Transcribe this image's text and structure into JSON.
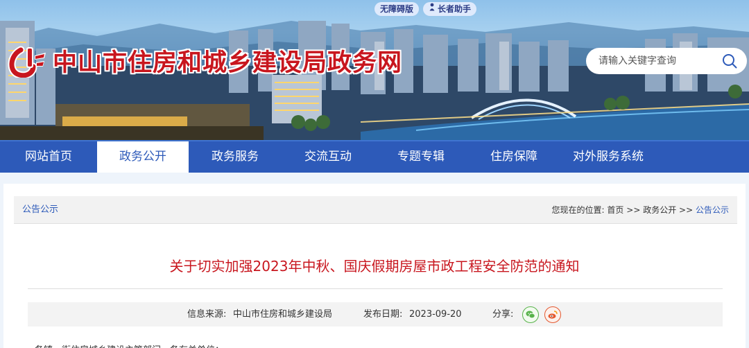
{
  "top_tools": {
    "accessible": "无障碍版",
    "elder": "长者助手",
    "elder_icon": "elder-person-icon"
  },
  "site": {
    "title": "中山市住房和城乡建设局政务网",
    "logo_icon": "zhongshan-housing-logo-icon",
    "brand_color": "#c8161e"
  },
  "search": {
    "placeholder": "请输入关键字查询",
    "icon": "search-icon"
  },
  "nav": {
    "items": [
      {
        "label": "网站首页",
        "active": false
      },
      {
        "label": "政务公开",
        "active": true
      },
      {
        "label": "政务服务",
        "active": false
      },
      {
        "label": "交流互动",
        "active": false
      },
      {
        "label": "专题专辑",
        "active": false
      },
      {
        "label": "住房保障",
        "active": false
      },
      {
        "label": "对外服务系统",
        "active": false
      }
    ],
    "bar_color": "#2d5ab9"
  },
  "section": {
    "name": "公告公示",
    "location_label": "您现在的位置:",
    "breadcrumb": [
      "首页",
      "政务公开",
      "公告公示"
    ],
    "separator": ">>"
  },
  "article": {
    "title": "关于切实加强2023年中秋、国庆假期房屋市政工程安全防范的通知",
    "source_label": "信息来源:",
    "source": "中山市住房和城乡建设局",
    "date_label": "发布日期:",
    "date": "2023-09-20",
    "share_label": "分享:",
    "share_icons": [
      "wechat-icon",
      "weibo-icon"
    ],
    "body_first_line": "各镇、街住房城乡建设主管部门，各有关单位："
  }
}
